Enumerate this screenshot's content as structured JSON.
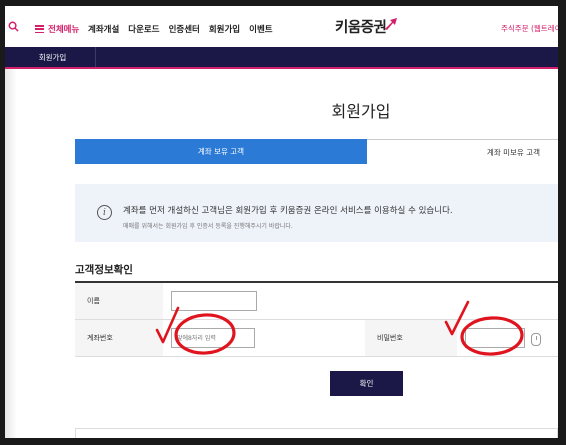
{
  "header": {
    "menu_label": "전체메뉴",
    "nav_items": [
      "계좌개설",
      "다운로드",
      "인증센터",
      "회원가입",
      "이벤트"
    ],
    "logo_text": "키움증권",
    "stock_link": "주식주문 (웹트레이",
    "brand_color": "#d3206a",
    "navy_color": "#1b1747"
  },
  "subnav": {
    "current": "회원가입"
  },
  "page": {
    "title": "회원가입"
  },
  "tabs": [
    {
      "label": "계좌 보유 고객",
      "active": true
    },
    {
      "label": "계좌 미보유 고객",
      "active": false
    }
  ],
  "notice": {
    "main": "계좌를 먼저 개설하신 고객님은 회원가입 후 키움증권 온라인 서비스를 이용하실 수 있습니다.",
    "sub": "매매를 위해서는 회원가입 후 인증서 등록을 진행해주시기 바랍니다."
  },
  "form": {
    "section_title": "고객정보확인",
    "name_label": "이름",
    "name_value": "",
    "account_label": "계좌번호",
    "account_placeholder": "앞에8자리 입력",
    "password_label": "비밀번호",
    "password_value": ""
  },
  "actions": {
    "confirm": "확인"
  },
  "icons": [
    "search-icon",
    "hamburger-icon",
    "info-icon",
    "keypad-icon"
  ],
  "annotation_color": "#e0141e"
}
